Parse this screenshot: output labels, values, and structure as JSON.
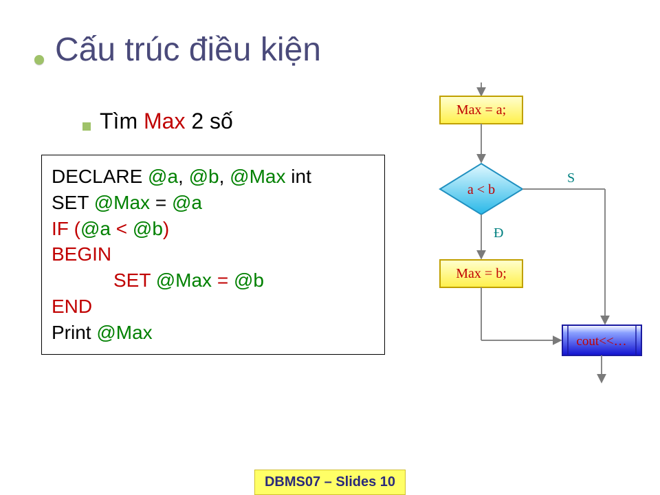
{
  "title": "Cấu trúc điều kiện",
  "subtitle": {
    "pre": "Tìm ",
    "hi": "Max",
    "post": " 2 số"
  },
  "code": {
    "l1a": "DECLARE ",
    "l1b": "@a",
    "l1c": ", ",
    "l1d": "@b",
    "l1e": ", ",
    "l1f": "@Max",
    "l1g": " int",
    "l2a": "SET ",
    "l2b": "@Max",
    "l2c": " = ",
    "l2d": "@a",
    "l3a": "IF ",
    "l3b": "(",
    "l3c": "@a",
    "l3d": " < ",
    "l3e": "@b",
    "l3f": ")",
    "l4": "BEGIN",
    "l5a": "SET ",
    "l5b": "@Max",
    "l5c": " = ",
    "l5d": "@b",
    "l6": "END",
    "l7a": "Print ",
    "l7b": "@Max"
  },
  "flow": {
    "box1": "Max = a;",
    "cond": "a < b",
    "true": "Đ",
    "false": "S",
    "box2": "Max = b;",
    "out": "cout<<…"
  },
  "footer": "DBMS07 – Slides 10"
}
